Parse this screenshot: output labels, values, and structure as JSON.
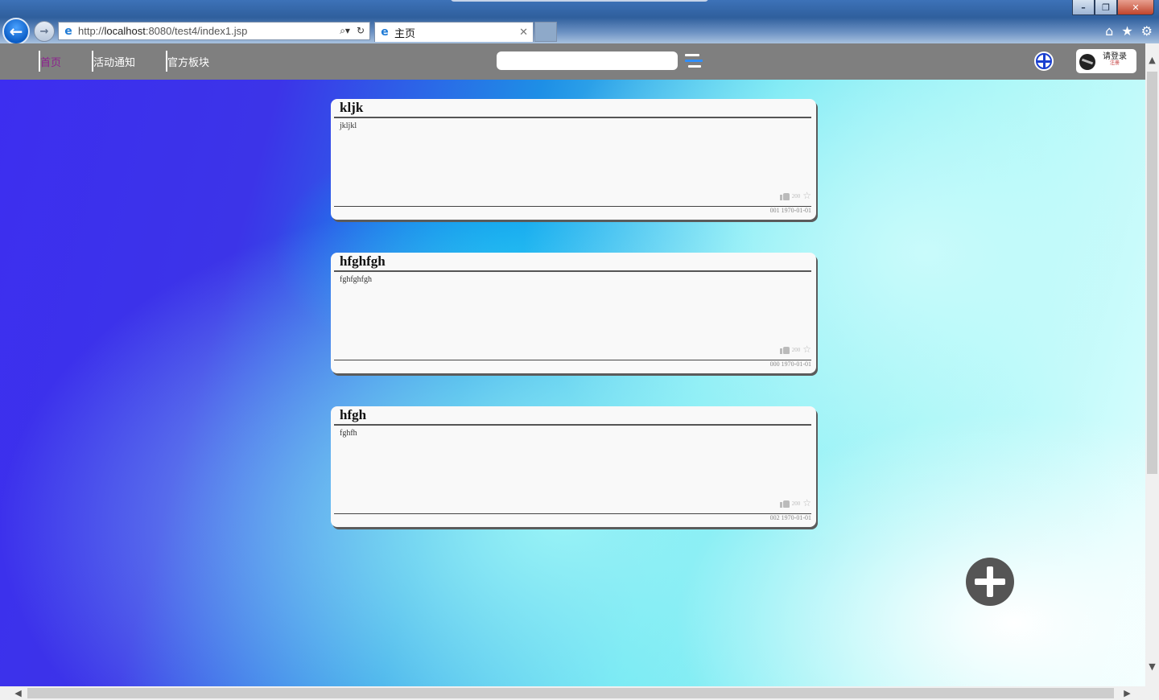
{
  "browser": {
    "url": "http://localhost:8080/test4/index1.jsp",
    "url_host": "localhost",
    "url_prefix": "http://",
    "url_suffix": ":8080/test4/index1.jsp",
    "tab_title": "主页"
  },
  "nav": {
    "items": [
      {
        "label": "首页"
      },
      {
        "label": "活动通知"
      },
      {
        "label": "官方板块"
      }
    ]
  },
  "search": {
    "placeholder": ""
  },
  "login": {
    "label": "请登录",
    "sub": "注册"
  },
  "posts": [
    {
      "title": "kljk",
      "content": "jkljkl",
      "likes": "200",
      "footer": "001 1970-01-01"
    },
    {
      "title": "hfghfgh",
      "content": "fghfghfgh",
      "likes": "200",
      "footer": "000 1970-01-01"
    },
    {
      "title": "hfgh",
      "content": "fghfh",
      "likes": "200",
      "footer": "002 1970-01-01"
    }
  ],
  "colors": {
    "topbar": "#7f7f7f",
    "active_nav": "#8d1f8f",
    "fab": "#555555"
  }
}
